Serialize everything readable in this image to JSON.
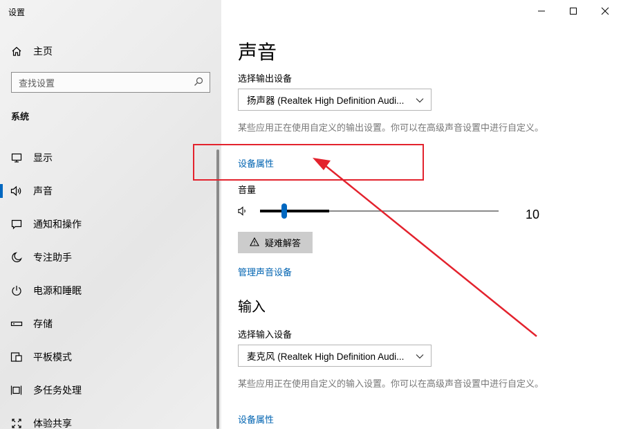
{
  "window": {
    "title": "设置",
    "controls": [
      "minimize",
      "maximize",
      "close"
    ]
  },
  "sidebar": {
    "home_label": "主页",
    "search_placeholder": "查找设置",
    "section_title": "系统",
    "items": [
      {
        "label": "显示",
        "icon": "display-icon"
      },
      {
        "label": "声音",
        "icon": "speaker-icon",
        "active": true
      },
      {
        "label": "通知和操作",
        "icon": "notification-icon"
      },
      {
        "label": "专注助手",
        "icon": "moon-icon"
      },
      {
        "label": "电源和睡眠",
        "icon": "power-icon"
      },
      {
        "label": "存储",
        "icon": "storage-icon"
      },
      {
        "label": "平板模式",
        "icon": "tablet-icon"
      },
      {
        "label": "多任务处理",
        "icon": "multitask-icon"
      },
      {
        "label": "体验共享",
        "icon": "share-icon"
      }
    ]
  },
  "main": {
    "title": "声音",
    "output": {
      "label": "选择输出设备",
      "device": "扬声器 (Realtek High Definition Audi...",
      "description": "某些应用正在使用自定义的输出设置。你可以在高级声音设置中进行自定义。",
      "properties_link": "设备属性"
    },
    "volume": {
      "label": "音量",
      "value_text": "10",
      "level": 0.1
    },
    "troubleshoot_label": "疑难解答",
    "manage_link": "管理声音设备",
    "input": {
      "heading": "输入",
      "label": "选择输入设备",
      "device": "麦克风 (Realtek High Definition Audi...",
      "description": "某些应用正在使用自定义的输入设置。你可以在高级声音设置中进行自定义。",
      "properties_link": "设备属性"
    }
  },
  "colors": {
    "accent": "#0067c0",
    "link": "#0063b1",
    "annotation": "#e3222d"
  }
}
